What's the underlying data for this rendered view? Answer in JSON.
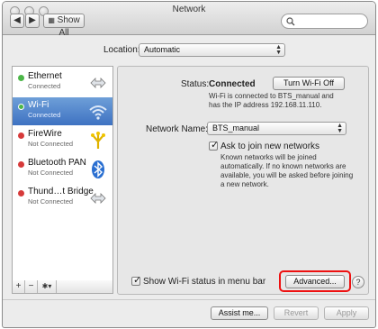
{
  "window": {
    "title": "Network"
  },
  "toolbar": {
    "show_all": "Show All",
    "search_placeholder": ""
  },
  "location": {
    "label": "Location:",
    "value": "Automatic"
  },
  "services": [
    {
      "name": "Ethernet",
      "status": "Connected",
      "dot": "#4cb648",
      "icon": "ethernet-icon"
    },
    {
      "name": "Wi-Fi",
      "status": "Connected",
      "dot": "#4cb648",
      "icon": "wifi-icon"
    },
    {
      "name": "FireWire",
      "status": "Not Connected",
      "dot": "#d63a3a",
      "icon": "firewire-icon"
    },
    {
      "name": "Bluetooth PAN",
      "status": "Not Connected",
      "dot": "#d63a3a",
      "icon": "bluetooth-icon"
    },
    {
      "name": "Thund…t Bridge",
      "status": "Not Connected",
      "dot": "#d63a3a",
      "icon": "thunderbolt-bridge-icon"
    }
  ],
  "sidebar_tools": {
    "add": "+",
    "remove": "−",
    "gear": "✱▾"
  },
  "panel": {
    "status_label": "Status:",
    "status_value": "Connected",
    "turn_off_button": "Turn Wi-Fi Off",
    "status_detail": "Wi-Fi is connected to BTS_manual and has the IP address 192.168.11.110.",
    "network_name_label": "Network Name:",
    "network_name_value": "BTS_manual",
    "ask_join_label": "Ask to join new networks",
    "ask_join_checked": true,
    "ask_join_detail": "Known networks will be joined automatically. If no known networks are available, you will be asked before joining a new network.",
    "show_status_label": "Show Wi-Fi status in menu bar",
    "show_status_checked": true,
    "advanced_button": "Advanced...",
    "help": "?"
  },
  "footer": {
    "assist": "Assist me...",
    "revert": "Revert",
    "apply": "Apply"
  },
  "colors": {
    "selection": "#4a7fcb",
    "highlight_box": "#e11111",
    "connected": "#4cb648",
    "not_connected": "#d63a3a"
  }
}
